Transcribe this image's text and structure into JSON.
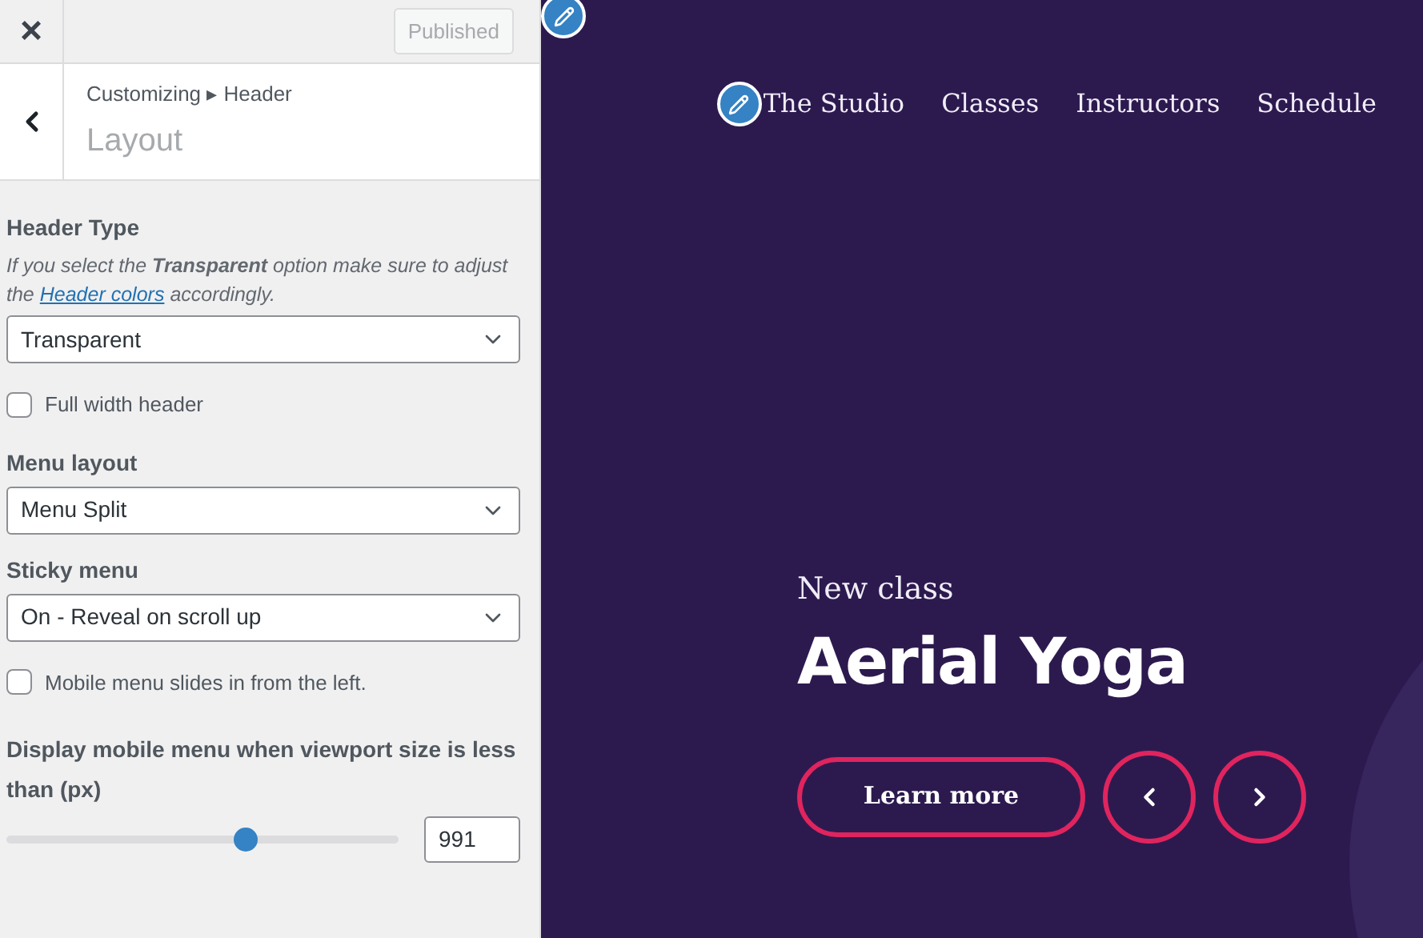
{
  "topbar": {
    "close": "×",
    "publish_button": "Published"
  },
  "header": {
    "breadcrumb": "Customizing ▸ Header",
    "title": "Layout"
  },
  "controls": [
    {
      "kind": "select",
      "label": "Header Type",
      "description_before": "If you select the **Transparent** option make sure to adjust the",
      "description_link": "Header colors",
      "description_after": "accordingly.",
      "value": "Transparent"
    },
    {
      "kind": "checkbox",
      "label": "Full width header",
      "checked": false
    },
    {
      "kind": "select",
      "label": "Menu layout",
      "value": "Menu Split"
    },
    {
      "kind": "select",
      "label": "Sticky menu",
      "value": "On - Reveal on scroll up"
    },
    {
      "kind": "checkbox",
      "label": "Mobile menu slides in from the left.",
      "checked": false
    },
    {
      "kind": "slider",
      "label": "Display mobile menu when viewport size is less than (px)",
      "level": 0.61,
      "value": "991"
    }
  ],
  "preview": {
    "nav": [
      "The Studio",
      "Classes",
      "Instructors",
      "Schedule"
    ],
    "eyebrow": "New class",
    "title": "Aerial Yoga",
    "button": "Learn more"
  }
}
